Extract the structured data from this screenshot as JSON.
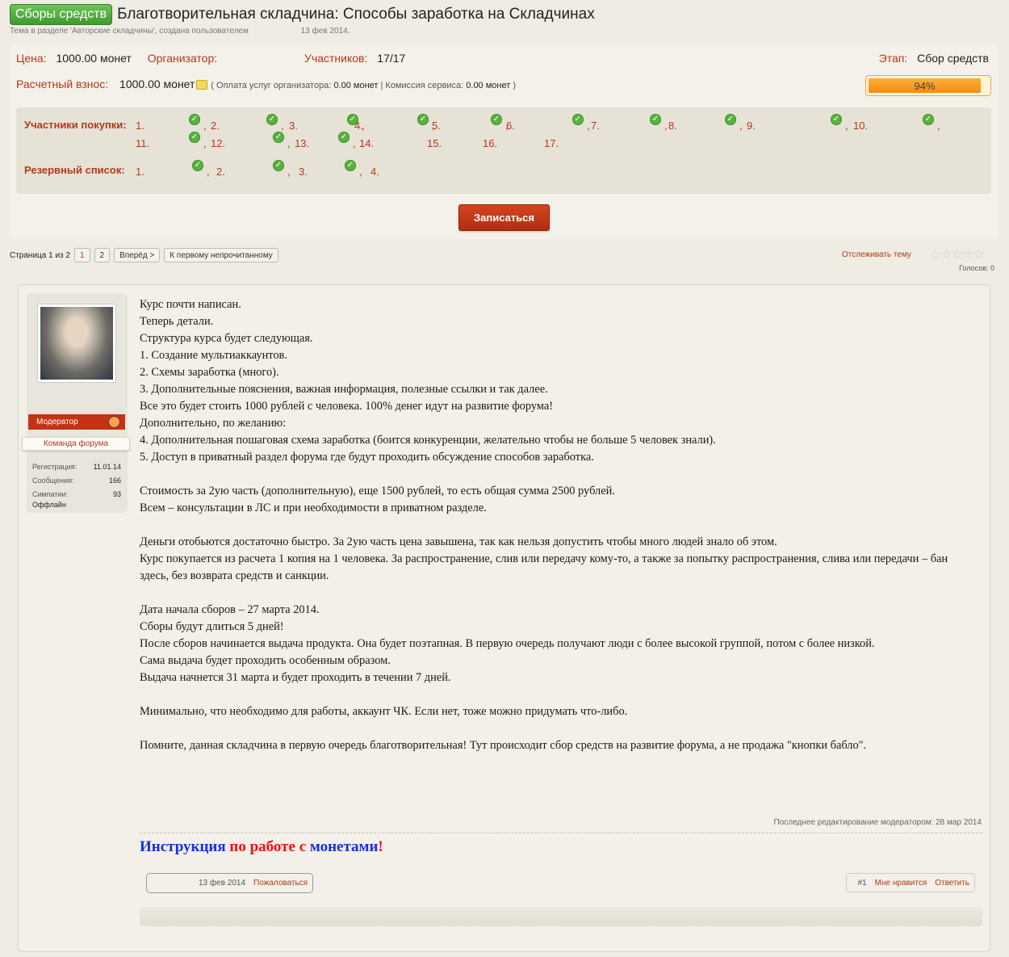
{
  "header": {
    "prefix": "Сборы средств",
    "title": "Благотворительная складчина: Способы заработка на Складчинах",
    "subtitle": "Тема в разделе 'Авторские складчины', создана пользователем",
    "date": "13 фев 2014."
  },
  "info": {
    "price_label": "Цена:",
    "price_value": "1000.00 монет",
    "organizer_label": "Организатор:",
    "participants_label": "Участников:",
    "participants_value": "17/17",
    "stage_label": "Этап:",
    "stage_value": "Сбор средств",
    "fee_label": "Расчетный взнос:",
    "fee_value": "1000.00 монет",
    "fee_note_open": "( Оплата услуг организатора: ",
    "fee_org_value": "0.00 монет",
    "fee_note_sep": " | Комиссия сервиса: ",
    "fee_service_value": "0.00 монет",
    "fee_note_close": " )",
    "progress_percent": 94,
    "progress_label": "94%"
  },
  "members": {
    "buyers_label": "Участники покупки:",
    "buyers": [
      "1.",
      "2.",
      "3.",
      "4.",
      "5.",
      "6.",
      "7.",
      "8.",
      "9.",
      "10.",
      "11.",
      "12.",
      "13.",
      "14.",
      "15.",
      "16.",
      "17."
    ],
    "reserve_label": "Резервный список:",
    "reserve": [
      "1.",
      "2.",
      "3.",
      "4."
    ],
    "signup_button": "Записаться"
  },
  "pager": {
    "page_text": "Страница 1 из 2",
    "pages": [
      "1",
      "2"
    ],
    "next": "Вперёд >",
    "first_unread": "К первому непрочитанному",
    "watch": "Отслеживать тему",
    "stars": "☆☆☆☆☆",
    "votes": "Голосов: 0"
  },
  "user": {
    "role": "Модератор",
    "team": "Команда форума",
    "reg_label": "Регистрация:",
    "reg_value": "11.01.14",
    "msgs_label": "Сообщения:",
    "msgs_value": "166",
    "likes_label": "Симпатии:",
    "likes_value": "93",
    "status": "Оффлайн"
  },
  "post": {
    "lines": [
      "Курс почти написан.",
      "Теперь детали.",
      "Структура курса будет следующая.",
      "1. Создание мультиаккаунтов.",
      "2. Схемы заработка (много).",
      "3. Дополнительные пояснения, важная информация, полезные ссылки и так далее.",
      "Все это будет стоить 1000 рублей с человека. 100% денег идут на развитие форума!",
      "Дополнительно, по желанию:",
      "4. Дополнительная пошаговая схема заработка (боится конкуренции, желательно чтобы не больше 5 человек знали).",
      "5. Доступ в приватный раздел форума где будут проходить обсуждение способов заработка.",
      "",
      "Стоимость за 2ую часть (дополнительную), еще 1500 рублей, то есть общая сумма 2500 рублей.",
      "Всем – консультации в ЛС и при необходимости в приватном разделе.",
      "",
      "Деньги отобьются достаточно быстро. За 2ую часть цена завышена, так как нельзя допустить чтобы много людей знало об этом.",
      "Курс покупается из расчета 1 копия на 1 человека. За распространение, слив или передачу кому-то, а также за попытку распространения, слива или передачи – бан здесь, без возврата средств и санкции.",
      "",
      "Дата начала сборов – 27 марта 2014.",
      "Сборы будут длиться 5 дней!",
      "После сборов начинается выдача продукта. Она будет поэтапная. В первую очередь получают люди с более высокой группой, потом с более низкой.",
      "Сама выдача будет проходить особенным образом.",
      "Выдача начнется 31 марта и будет проходить в течении 7 дней.",
      "",
      "Минимально, что необходимо для работы, аккаунт ЧК. Если нет, тоже можно придумать что-либо.",
      "",
      "Помните, данная складчина в первую очередь благотворительная! Тут происходит сбор средств на развитие форума, а не продажа \"кнопки бабло\"."
    ],
    "edited": "Последнее редактирование модератором: 28 мар 2014",
    "sig_part1": "Инструкция",
    "sig_part2": "по работе с",
    "sig_part3": "монетами",
    "sig_part4": "!",
    "date": "13 фев 2014",
    "report": "Пожаловаться",
    "number": "#1",
    "like": "Мне нравится",
    "reply": "Ответить"
  }
}
